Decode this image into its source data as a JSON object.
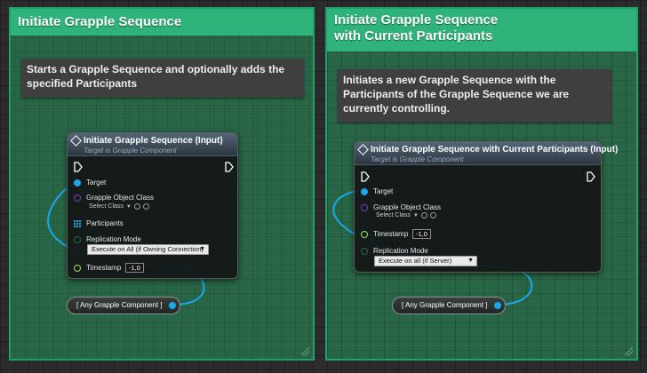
{
  "colors": {
    "comment_fill": "#2a9960",
    "comment_title": "#2fb37a",
    "node_header": "#4a5c6e",
    "object_pin": "#19a8ea",
    "class_pin": "#7b3fbf",
    "float_pin": "#a7e05a",
    "wire": "#19a8ea"
  },
  "left_group": {
    "comment_title": "Initiate Grapple Sequence",
    "comment_description": "Starts a Grapple Sequence and optionally adds the specified Participants",
    "node": {
      "icon": "function-icon",
      "title": "Initiate Grapple Sequence (Input)",
      "subtitle": "Target is Grapple Component",
      "pins": {
        "target": "Target",
        "grapple_object_class": "Grapple Object Class",
        "select_class": "Select Class",
        "participants": "Participants",
        "replication_mode": "Replication Mode",
        "replication_value": "Execute on All (if Owning Connection)",
        "timestamp": "Timestamp",
        "timestamp_value": "-1,0"
      }
    },
    "variable_node": "[ Any Grapple Component ]"
  },
  "right_group": {
    "comment_title_line1": "Initiate Grapple Sequence",
    "comment_title_line2": "with Current Participants",
    "comment_description": "Initiates a new Grapple Sequence with the Participants of the Grapple Sequence we are currently controlling.",
    "node": {
      "icon": "function-icon",
      "title": "Initiate Grapple Sequence with Current Participants (Input)",
      "subtitle": "Target is Grapple Component",
      "pins": {
        "target": "Target",
        "grapple_object_class": "Grapple Object Class",
        "select_class": "Select Class",
        "timestamp": "Timestamp",
        "timestamp_value": "-1,0",
        "replication_mode": "Replication Mode",
        "replication_value": "Execute on all (if Server)"
      }
    },
    "variable_node": "[ Any Grapple Component ]"
  }
}
